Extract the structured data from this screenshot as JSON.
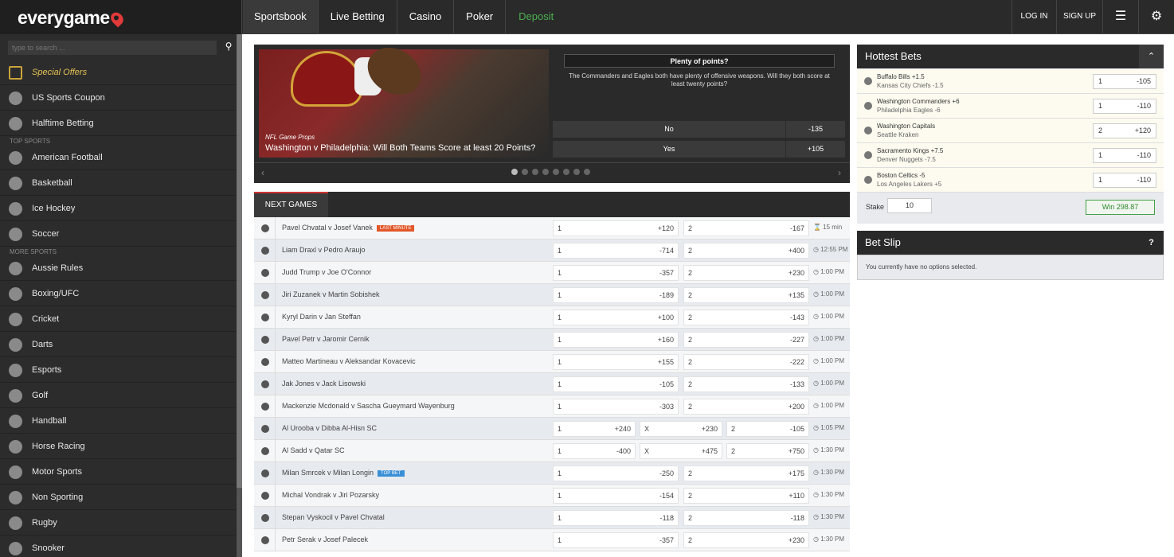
{
  "brand": {
    "name": "everygame"
  },
  "nav": {
    "items": [
      "Sportsbook",
      "Live Betting",
      "Casino",
      "Poker",
      "Deposit"
    ],
    "login": "LOG IN",
    "signup": "SIGN UP"
  },
  "sidebar": {
    "search_placeholder": "type to search ...",
    "top": [
      {
        "label": "Special Offers",
        "icon": "gift-icon"
      },
      {
        "label": "US Sports Coupon",
        "icon": "coupon-icon"
      },
      {
        "label": "Halftime Betting",
        "icon": "halftime-icon"
      }
    ],
    "top_sports_heading": "TOP SPORTS",
    "top_sports": [
      {
        "label": "American Football",
        "icon": "american-football-icon"
      },
      {
        "label": "Basketball",
        "icon": "basketball-icon"
      },
      {
        "label": "Ice Hockey",
        "icon": "ice-hockey-icon"
      },
      {
        "label": "Soccer",
        "icon": "soccer-icon"
      }
    ],
    "more_sports_heading": "MORE SPORTS",
    "more_sports": [
      {
        "label": "Aussie Rules",
        "icon": "aussie-rules-icon"
      },
      {
        "label": "Boxing/UFC",
        "icon": "boxing-icon"
      },
      {
        "label": "Cricket",
        "icon": "cricket-icon"
      },
      {
        "label": "Darts",
        "icon": "darts-icon"
      },
      {
        "label": "Esports",
        "icon": "esports-icon"
      },
      {
        "label": "Golf",
        "icon": "golf-icon"
      },
      {
        "label": "Handball",
        "icon": "handball-icon"
      },
      {
        "label": "Horse Racing",
        "icon": "horse-racing-icon"
      },
      {
        "label": "Motor Sports",
        "icon": "motor-sports-icon"
      },
      {
        "label": "Non Sporting",
        "icon": "non-sporting-icon"
      },
      {
        "label": "Rugby",
        "icon": "rugby-icon"
      },
      {
        "label": "Snooker",
        "icon": "snooker-icon"
      }
    ]
  },
  "hero": {
    "caption_small": "NFL Game Props",
    "caption": "Washington v Philadelphia: Will Both Teams Score at least 20 Points?",
    "question": "Plenty of points?",
    "description": "The Commanders and Eagles both have plenty of offensive weapons. Will they both score at least twenty points?",
    "options": [
      {
        "label": "No",
        "odds": "-135"
      },
      {
        "label": "Yes",
        "odds": "+105"
      }
    ],
    "dots": 8,
    "active_dot": 0
  },
  "next_games": {
    "tab": "NEXT GAMES",
    "rows": [
      {
        "name": "Pavel Chvatal v Josef Vanek",
        "badge": "LAST MINUTE",
        "badge_type": "lm",
        "odds": [
          [
            "1",
            "+120"
          ],
          [
            "2",
            "-167"
          ]
        ],
        "time": "⌛ 15 min"
      },
      {
        "name": "Liam Draxl v Pedro Araujo",
        "odds": [
          [
            "1",
            "-714"
          ],
          [
            "2",
            "+400"
          ]
        ],
        "time": "12:55 PM"
      },
      {
        "name": "Judd Trump v Joe O'Connor",
        "odds": [
          [
            "1",
            "-357"
          ],
          [
            "2",
            "+230"
          ]
        ],
        "time": "1:00 PM"
      },
      {
        "name": "Jiri Zuzanek v Martin Sobishek",
        "odds": [
          [
            "1",
            "-189"
          ],
          [
            "2",
            "+135"
          ]
        ],
        "time": "1:00 PM"
      },
      {
        "name": "Kyryl Darin v Jan Steffan",
        "odds": [
          [
            "1",
            "+100"
          ],
          [
            "2",
            "-143"
          ]
        ],
        "time": "1:00 PM"
      },
      {
        "name": "Pavel Petr v Jaromir Cernik",
        "odds": [
          [
            "1",
            "+160"
          ],
          [
            "2",
            "-227"
          ]
        ],
        "time": "1:00 PM"
      },
      {
        "name": "Matteo Martineau v Aleksandar Kovacevic",
        "odds": [
          [
            "1",
            "+155"
          ],
          [
            "2",
            "-222"
          ]
        ],
        "time": "1:00 PM"
      },
      {
        "name": "Jak Jones v Jack Lisowski",
        "odds": [
          [
            "1",
            "-105"
          ],
          [
            "2",
            "-133"
          ]
        ],
        "time": "1:00 PM"
      },
      {
        "name": "Mackenzie Mcdonald v Sascha Gueymard Wayenburg",
        "odds": [
          [
            "1",
            "-303"
          ],
          [
            "2",
            "+200"
          ]
        ],
        "time": "1:00 PM"
      },
      {
        "name": "Al Urooba v Dibba Al-Hisn SC",
        "odds": [
          [
            "1",
            "+240"
          ],
          [
            "X",
            "+230"
          ],
          [
            "2",
            "-105"
          ]
        ],
        "time": "1:05 PM"
      },
      {
        "name": "Al Sadd v Qatar SC",
        "odds": [
          [
            "1",
            "-400"
          ],
          [
            "X",
            "+475"
          ],
          [
            "2",
            "+750"
          ]
        ],
        "time": "1:30 PM"
      },
      {
        "name": "Milan Smrcek v Milan Longin",
        "badge": "TOP BET",
        "badge_type": "tb",
        "odds": [
          [
            "1",
            "-250"
          ],
          [
            "2",
            "+175"
          ]
        ],
        "time": "1:30 PM"
      },
      {
        "name": "Michal Vondrak v Jiri Pozarsky",
        "odds": [
          [
            "1",
            "-154"
          ],
          [
            "2",
            "+110"
          ]
        ],
        "time": "1:30 PM"
      },
      {
        "name": "Stepan Vyskocil v Pavel Chvatal",
        "odds": [
          [
            "1",
            "-118"
          ],
          [
            "2",
            "-118"
          ]
        ],
        "time": "1:30 PM"
      },
      {
        "name": "Petr Serak v Josef Palecek",
        "odds": [
          [
            "1",
            "-357"
          ],
          [
            "2",
            "+230"
          ]
        ],
        "time": "1:30 PM"
      }
    ]
  },
  "hottest_bets": {
    "title": "Hottest Bets",
    "rows": [
      {
        "line1": "Buffalo Bills +1.5",
        "line2": "Kansas City Chiefs -1.5",
        "sel": "1",
        "odds": "-105"
      },
      {
        "line1": "Washington Commanders +6",
        "line2": "Philadelphia Eagles -6",
        "sel": "1",
        "odds": "-110"
      },
      {
        "line1": "Washington Capitals",
        "line2": "Seattle Kraken",
        "sel": "2",
        "odds": "+120"
      },
      {
        "line1": "Sacramento Kings +7.5",
        "line2": "Denver Nuggets -7.5",
        "sel": "1",
        "odds": "-110"
      },
      {
        "line1": "Boston Celtics -5",
        "line2": "Los Angeles Lakers +5",
        "sel": "1",
        "odds": "-110"
      }
    ],
    "stake_label": "Stake",
    "stake_value": "10",
    "win": "Win 298.87"
  },
  "bet_slip": {
    "title": "Bet Slip",
    "help": "?",
    "empty": "You currently have no options selected."
  }
}
